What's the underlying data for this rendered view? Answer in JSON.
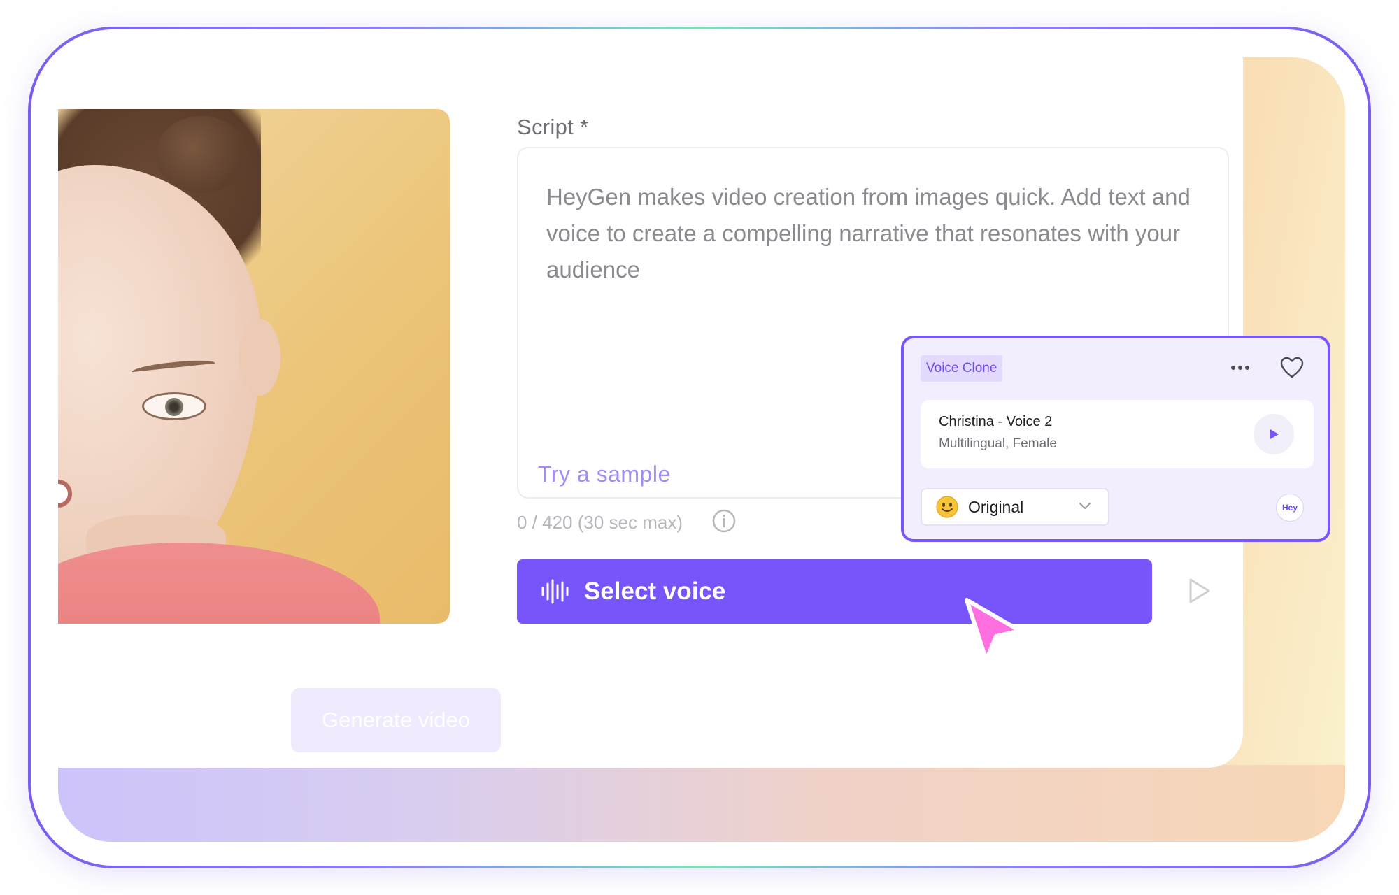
{
  "script": {
    "label": "Script *",
    "text": "HeyGen makes video creation from images quick. Add text and voice to create a compelling narrative that resonates with your audience",
    "try_sample": "Try a sample",
    "counter": "0 / 420 (30 sec max)"
  },
  "actions": {
    "select_voice_label": "Select voice",
    "generate_label": "Generate video"
  },
  "voice_popup": {
    "badge": "Voice Clone",
    "voice_name": "Christina - Voice 2",
    "voice_meta": "Multilingual, Female",
    "emotion_selected": "Original",
    "logo_text": "Hey"
  },
  "icons": {
    "wave": "audio-wave-icon",
    "play": "play-icon",
    "info": "info-icon",
    "more": "more-dots-icon",
    "heart": "heart-icon",
    "emoji": "smile-emoji-icon",
    "chevron": "chevron-down-icon",
    "cursor": "cursor-pointer-icon"
  },
  "colors": {
    "accent": "#7755fb",
    "popup_border": "#7857f6",
    "cursor": "#ff6fe0",
    "try_sample": "#a58cf5"
  }
}
